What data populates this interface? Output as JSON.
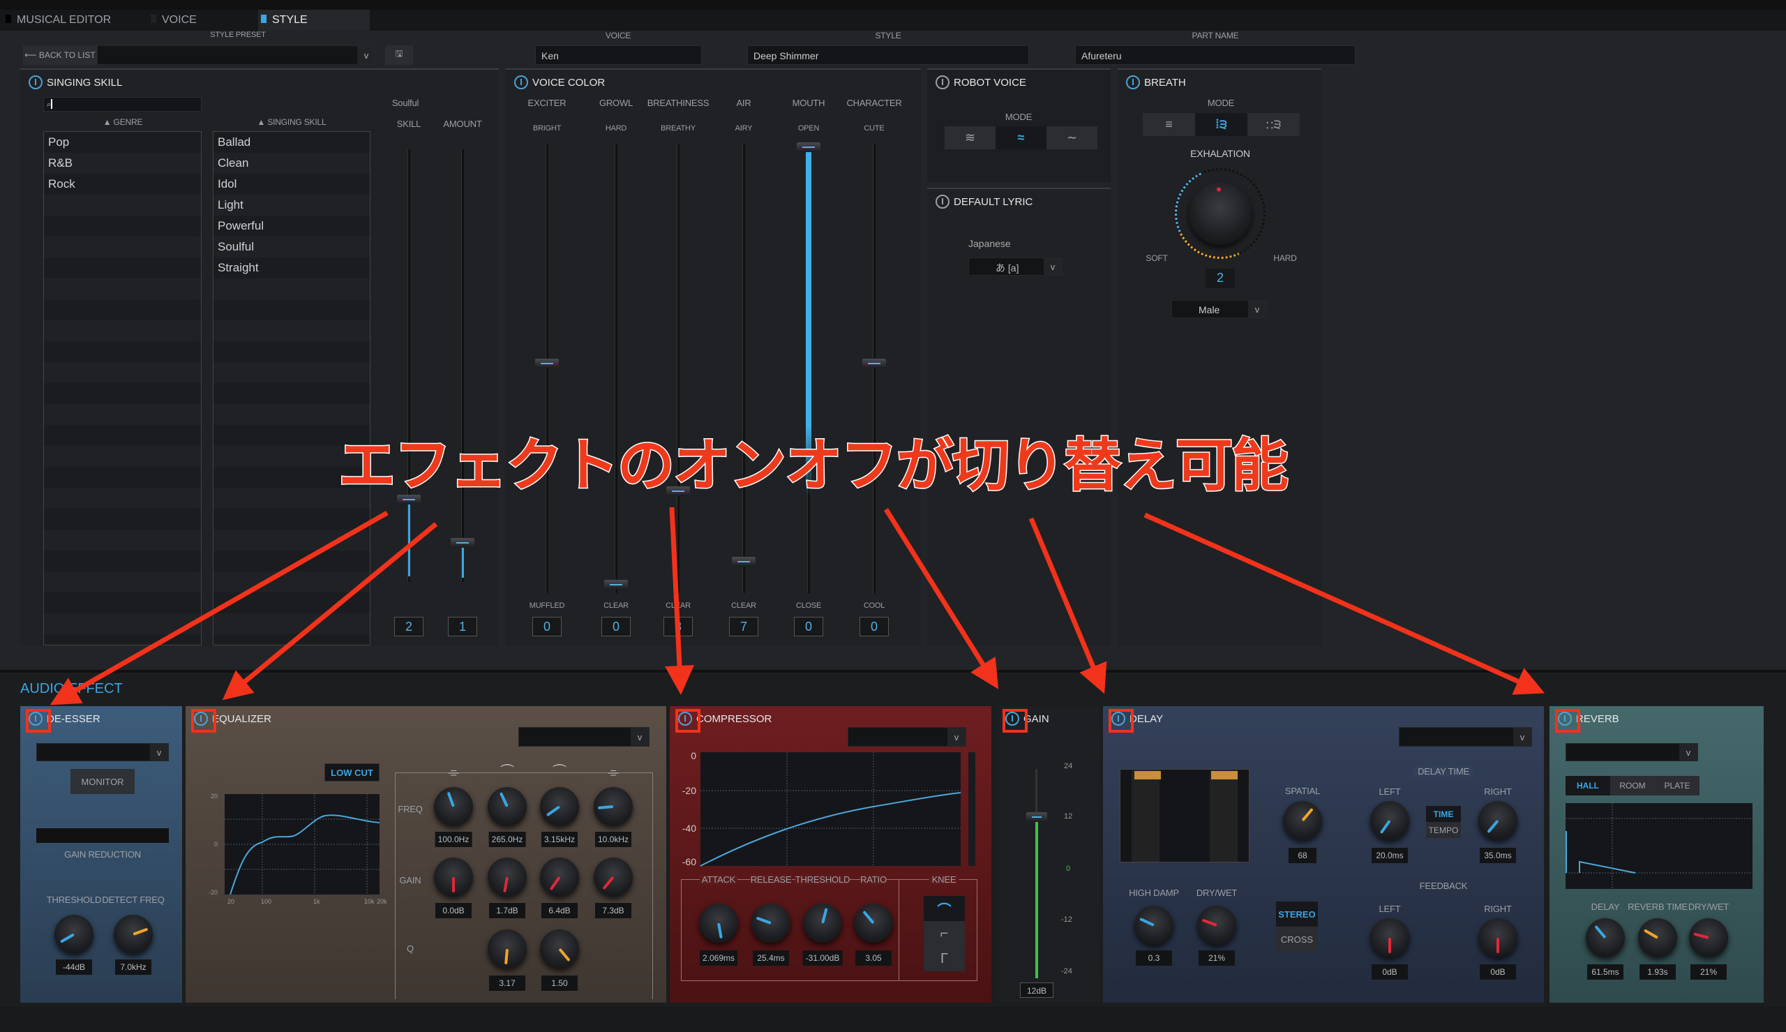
{
  "tabs": [
    {
      "label": "MUSICAL EDITOR"
    },
    {
      "label": "VOICE"
    },
    {
      "label": "STYLE",
      "active": true
    }
  ],
  "header": {
    "style_preset_label": "STYLE PRESET",
    "back_to_list": "BACK TO LIST",
    "voice_label": "VOICE",
    "voice_value": "Ken",
    "style_label": "STYLE",
    "style_value": "Deep Shimmer",
    "part_name_label": "PART NAME",
    "part_name_value": "Afureteru"
  },
  "singing_skill": {
    "title": "SINGING SKILL",
    "search_value": "",
    "genre_header": "▲ GENRE",
    "skill_header": "▲ SINGING SKILL",
    "genres": [
      "Pop",
      "R&B",
      "Rock"
    ],
    "skills": [
      "Ballad",
      "Clean",
      "Idol",
      "Light",
      "Powerful",
      "Soulful",
      "Straight"
    ],
    "selected_skill": "Soulful",
    "skill_label": "SKILL",
    "amount_label": "AMOUNT",
    "skill_value": "2",
    "amount_value": "1"
  },
  "voice_color": {
    "title": "VOICE COLOR",
    "sliders": [
      {
        "name": "EXCITER",
        "top": "BRIGHT",
        "bottom": "MUFFLED",
        "value": "0"
      },
      {
        "name": "GROWL",
        "top": "HARD",
        "bottom": "CLEAR",
        "value": "0"
      },
      {
        "name": "BREATHINESS",
        "top": "BREATHY",
        "bottom": "CLEAR",
        "value": "8"
      },
      {
        "name": "AIR",
        "top": "AIRY",
        "bottom": "CLEAR",
        "value": "7"
      },
      {
        "name": "MOUTH",
        "top": "OPEN",
        "bottom": "CLOSE",
        "value": "0"
      },
      {
        "name": "CHARACTER",
        "top": "CUTE",
        "bottom": "COOL",
        "value": "0"
      }
    ]
  },
  "robot_voice": {
    "title": "ROBOT VOICE",
    "mode_label": "MODE",
    "selected_mode": 2
  },
  "default_lyric": {
    "title": "DEFAULT LYRIC",
    "language": "Japanese",
    "lyric": "あ [a]"
  },
  "breath": {
    "title": "BREATH",
    "mode_label": "MODE",
    "selected_mode": 2,
    "exhalation_label": "EXHALATION",
    "soft": "SOFT",
    "hard": "HARD",
    "value": "2",
    "voice_type": "Male"
  },
  "overlay_caption": "エフェクトのオンオフが切り替え可能",
  "audio_effect": {
    "title": "AUDIO EFFECT",
    "deesser": {
      "title": "DE-ESSER",
      "monitor": "MONITOR",
      "gain_reduction": "GAIN REDUCTION",
      "threshold_label": "THRESHOLD",
      "detect_freq_label": "DETECT FREQ",
      "threshold": "-44dB",
      "detect_freq": "7.0kHz"
    },
    "eq": {
      "title": "EQUALIZER",
      "low_cut": "LOW CUT",
      "freq_label": "FREQ",
      "gain_label": "GAIN",
      "q_label": "Q",
      "y_ticks": [
        "20",
        "0",
        "-20"
      ],
      "x_ticks": [
        "20",
        "100",
        "1k",
        "10k",
        "20k"
      ],
      "freqs": [
        "100.0Hz",
        "265.0Hz",
        "3.15kHz",
        "10.0kHz"
      ],
      "gains": [
        "0.0dB",
        "1.7dB",
        "6.4dB",
        "7.3dB"
      ],
      "qs": [
        "3.17",
        "1.50"
      ]
    },
    "compressor": {
      "title": "COMPRESSOR",
      "y_ticks": [
        "0",
        "-20",
        "-40",
        "-60"
      ],
      "attack_label": "ATTACK",
      "release_label": "RELEASE",
      "threshold_label": "THRESHOLD",
      "ratio_label": "RATIO",
      "knee_label": "KNEE",
      "attack": "2.069ms",
      "release": "25.4ms",
      "threshold": "-31.00dB",
      "ratio": "3.05"
    },
    "gain": {
      "title": "GAIN",
      "ticks": [
        "24",
        "12",
        "0",
        "-12",
        "-24"
      ],
      "value": "12dB"
    },
    "delay": {
      "title": "DELAY",
      "spatial_label": "SPATIAL",
      "spatial": "68",
      "delay_time_label": "DELAY TIME",
      "left_label": "LEFT",
      "right_label": "RIGHT",
      "time": "TIME",
      "tempo": "TEMPO",
      "left_time": "20.0ms",
      "right_time": "35.0ms",
      "feedback_label": "FEEDBACK",
      "left_fb": "0dB",
      "right_fb": "0dB",
      "high_damp_label": "HIGH DAMP",
      "dry_wet_label": "DRY/WET",
      "high_damp": "0.3",
      "dry_wet": "21%",
      "stereo": "STEREO",
      "cross": "CROSS"
    },
    "reverb": {
      "title": "REVERB",
      "types": [
        "HALL",
        "ROOM",
        "PLATE"
      ],
      "delay_label": "DELAY",
      "reverb_time_label": "REVERB TIME",
      "dry_wet_label": "DRY/WET",
      "delay": "61.5ms",
      "reverb_time": "1.93s",
      "dry_wet": "21%"
    }
  },
  "colors": {
    "accent": "#3aa6e4",
    "annotation": "#f3321b",
    "deesser_bg": "#3b5a78",
    "eq_bg": "#5a4e45",
    "compressor_bg": "#6a1c1e",
    "delay_bg": "#2e3a52",
    "reverb_bg": "#3f6466"
  }
}
